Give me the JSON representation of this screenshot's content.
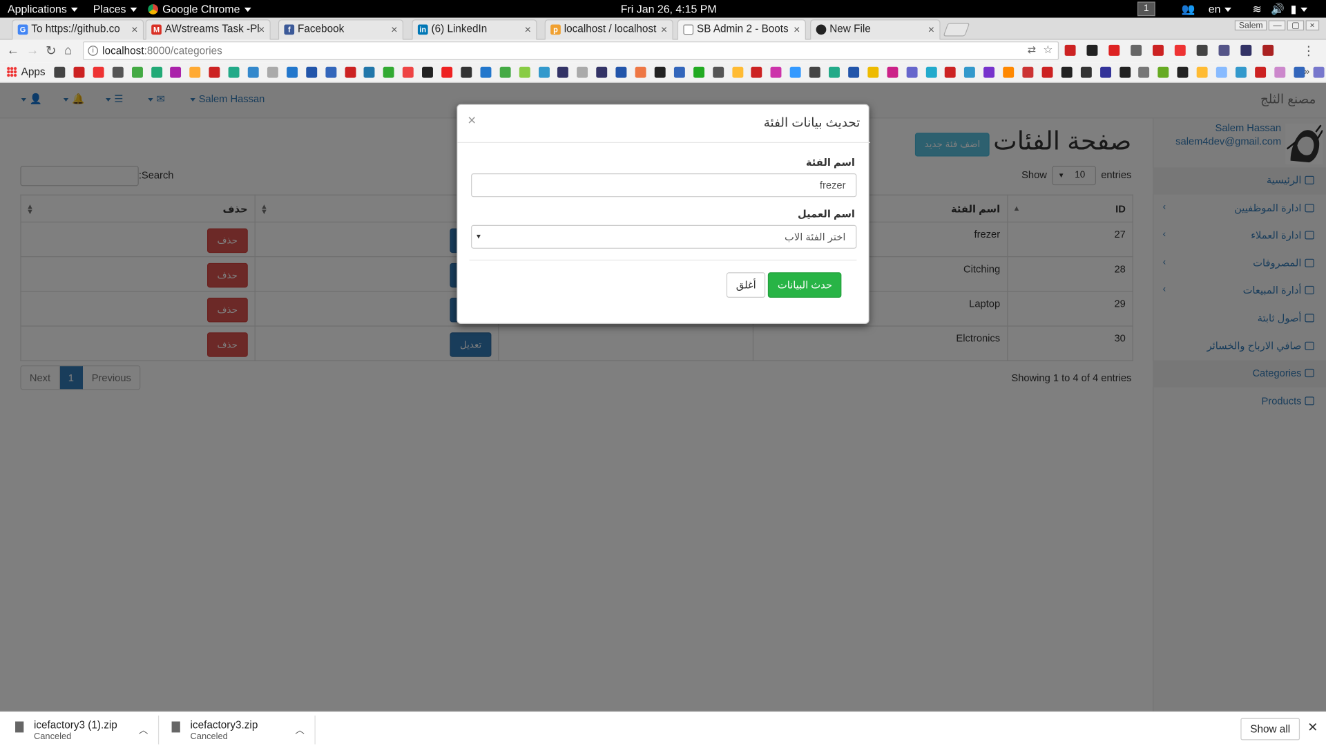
{
  "os": {
    "applications": "Applications",
    "places": "Places",
    "browser": "Google Chrome",
    "clock": "Fri Jan 26,  4:15 PM",
    "workspace": "1",
    "lang": "en"
  },
  "tabs": [
    {
      "label": "To https://github.co",
      "icon": "google-icon",
      "color": "#4285f4"
    },
    {
      "label": "AWstreams Task -Pl",
      "icon": "gmail-icon",
      "color": "#d93025"
    },
    {
      "label": "Facebook",
      "icon": "facebook-icon",
      "color": "#3b5998"
    },
    {
      "label": "(6) LinkedIn",
      "icon": "linkedin-icon",
      "color": "#0077b5"
    },
    {
      "label": "localhost / localhost",
      "icon": "phpmyadmin-icon",
      "color": "#f0a030"
    },
    {
      "label": "SB Admin 2 - Boots",
      "icon": "page-icon",
      "color": "#888"
    },
    {
      "label": "New File",
      "icon": "github-icon",
      "color": "#222"
    }
  ],
  "window_user": "Salem",
  "url": {
    "host": "localhost",
    "path": ":8000/categories"
  },
  "bookmarks": {
    "apps": "Apps"
  },
  "topnav": {
    "user": "Salem Hassan",
    "brand": "مصنع الثلج"
  },
  "sidebar": {
    "name": "Salem Hassan",
    "email": "salem4dev@gmail.com",
    "items": [
      {
        "label": "الرئيسية",
        "chevron": false
      },
      {
        "label": "ادارة الموظفيين",
        "chevron": true
      },
      {
        "label": "ادارة العملاء",
        "chevron": true
      },
      {
        "label": "المصروفات",
        "chevron": true
      },
      {
        "label": "أدارة المبيعات",
        "chevron": true
      },
      {
        "label": "أصول ثابتة",
        "chevron": false
      },
      {
        "label": "صافي الارباح والخسائر",
        "chevron": false
      },
      {
        "label": "Categories",
        "chevron": false
      },
      {
        "label": "Products",
        "chevron": false
      }
    ]
  },
  "main": {
    "title": "صفحة الفئات",
    "add_button": "اضف فئة جديد",
    "show": "Show",
    "show_value": "10",
    "entries": "entries",
    "search": ":Search",
    "columns": [
      "ID",
      "اسم الفئة",
      "",
      "",
      "حذف"
    ],
    "rows": [
      {
        "id": "27",
        "name": "frezer"
      },
      {
        "id": "28",
        "name": "Citching"
      },
      {
        "id": "29",
        "name": "Laptop"
      },
      {
        "id": "30",
        "name": "Elctronics"
      }
    ],
    "edit_label": "تعديل",
    "delete_label": "حذف",
    "info": "Showing 1 to 4 of 4 entries",
    "pager": {
      "next": "Next",
      "page": "1",
      "prev": "Previous"
    }
  },
  "modal": {
    "title": "تحديث بيانات الفئة",
    "close": "×",
    "label1": "اسم الفئة",
    "value1": "frezer",
    "label2": "اسم العميل",
    "value2": "اختر الفئة الاب",
    "save": "حدث البيانات",
    "cancel": "أغلق"
  },
  "downloads": [
    {
      "name": "icefactory3 (1).zip",
      "status": "Canceled"
    },
    {
      "name": "icefactory3.zip",
      "status": "Canceled"
    }
  ],
  "show_all": "Show all"
}
